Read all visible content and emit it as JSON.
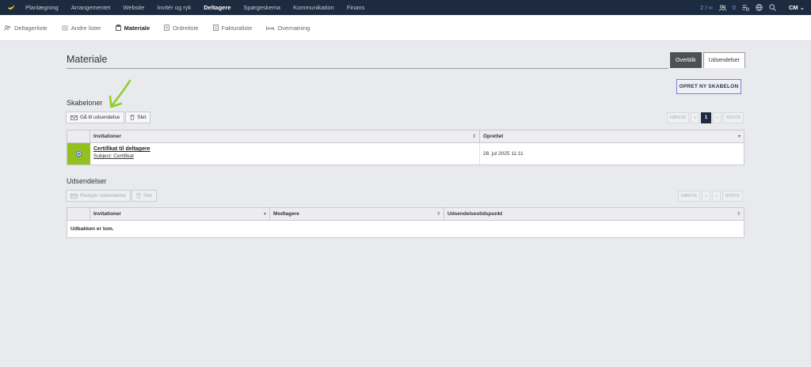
{
  "topnav": {
    "items": [
      "Planlægning",
      "Arrangementet",
      "Website",
      "Invitér og ryk",
      "Deltagere",
      "Spørgeskema",
      "Kommunikation",
      "Finans"
    ],
    "active_index": 4,
    "right": {
      "count1": "2 / ∞",
      "count2": "0",
      "user": "CM"
    }
  },
  "subnav": {
    "items": [
      {
        "label": "Deltagerliste",
        "icon": "people-icon"
      },
      {
        "label": "Andre lister",
        "icon": "list-icon"
      },
      {
        "label": "Materiale",
        "icon": "file-box-icon"
      },
      {
        "label": "Ordreliste",
        "icon": "receipt-icon"
      },
      {
        "label": "Fakturaliste",
        "icon": "document-icon"
      },
      {
        "label": "Overnatning",
        "icon": "bed-icon"
      }
    ],
    "active_index": 2
  },
  "page": {
    "title": "Materiale",
    "tabs": [
      "Overblik",
      "Udsendelser"
    ],
    "active_tab": 0,
    "new_template_button": "OPRET NY SKABELON"
  },
  "templates": {
    "title": "Skabeloner",
    "toolbar": {
      "send": "Gå til udsendelse",
      "delete": "Slet"
    },
    "pager": {
      "first": "FØRSTE",
      "prev": "«",
      "current": "1",
      "next": "»",
      "last": "SIDSTE"
    },
    "columns": [
      "Invitationer",
      "Oprettet"
    ],
    "rows": [
      {
        "title": "Certifikat til deltagere",
        "subject": "Subject: Certifikat",
        "created": "28. jul 2025 11:11",
        "selected": true
      }
    ]
  },
  "sendouts": {
    "title": "Udsendelser",
    "toolbar": {
      "edit": "Redigér udsendelse",
      "delete": "Slet"
    },
    "pager": {
      "first": "FØRSTE",
      "prev": "«",
      "next": "»",
      "last": "SIDSTE"
    },
    "columns": [
      "Invitationer",
      "Modtagere",
      "Udsendelsestidspunkt"
    ],
    "empty_text": "Udbakken er tom."
  },
  "colors": {
    "nav_bg": "#1c2b3f",
    "selection_green": "#93c01f",
    "annotation_arrow": "#8fcf2a",
    "primary_button_border": "#7b83c7"
  }
}
